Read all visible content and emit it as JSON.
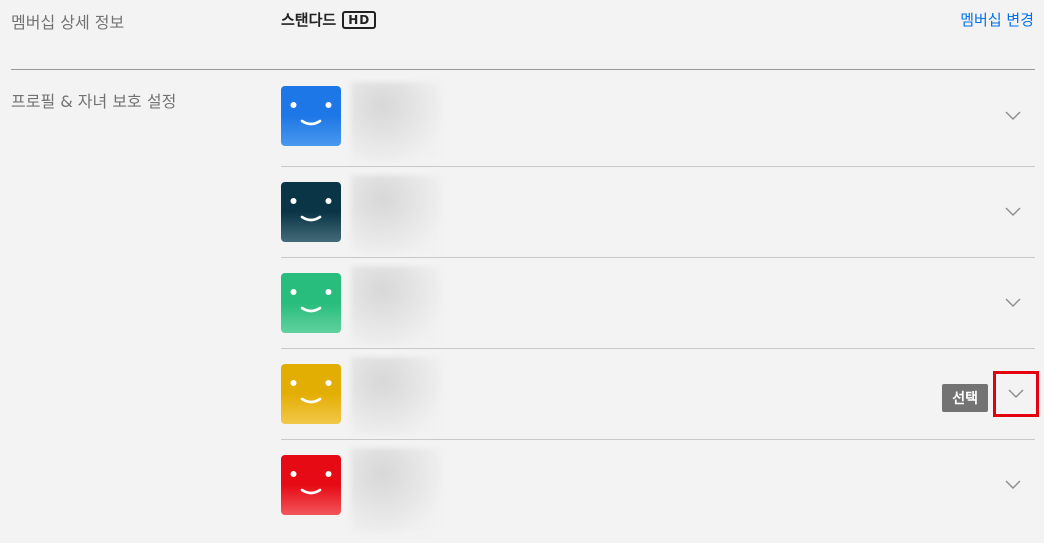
{
  "membership": {
    "label": "멤버십 상세 정보",
    "plan_name": "스탠다드",
    "plan_badge": "HD",
    "change_link": "멤버십 변경",
    "link_color": "#0071eb"
  },
  "profiles_section": {
    "label": "프로필 & 자녀 보호 설정",
    "profiles": [
      {
        "avatar_top": "#1e77e6",
        "avatar_bottom": "#4a98ef",
        "icon": "smiley-avatar-icon"
      },
      {
        "avatar_top": "#0a3547",
        "avatar_bottom": "#446b78",
        "icon": "smiley-avatar-icon"
      },
      {
        "avatar_top": "#28bd7c",
        "avatar_bottom": "#61d19f",
        "icon": "smiley-avatar-icon"
      },
      {
        "avatar_top": "#e3ae04",
        "avatar_bottom": "#f2c84a",
        "icon": "smiley-avatar-icon"
      },
      {
        "avatar_top": "#e60a14",
        "avatar_bottom": "#f3555c",
        "icon": "smiley-avatar-icon"
      }
    ],
    "expand_icon": "chevron-down-icon"
  },
  "tooltip": {
    "label": "선택"
  },
  "highlight_color": "#e4000f"
}
